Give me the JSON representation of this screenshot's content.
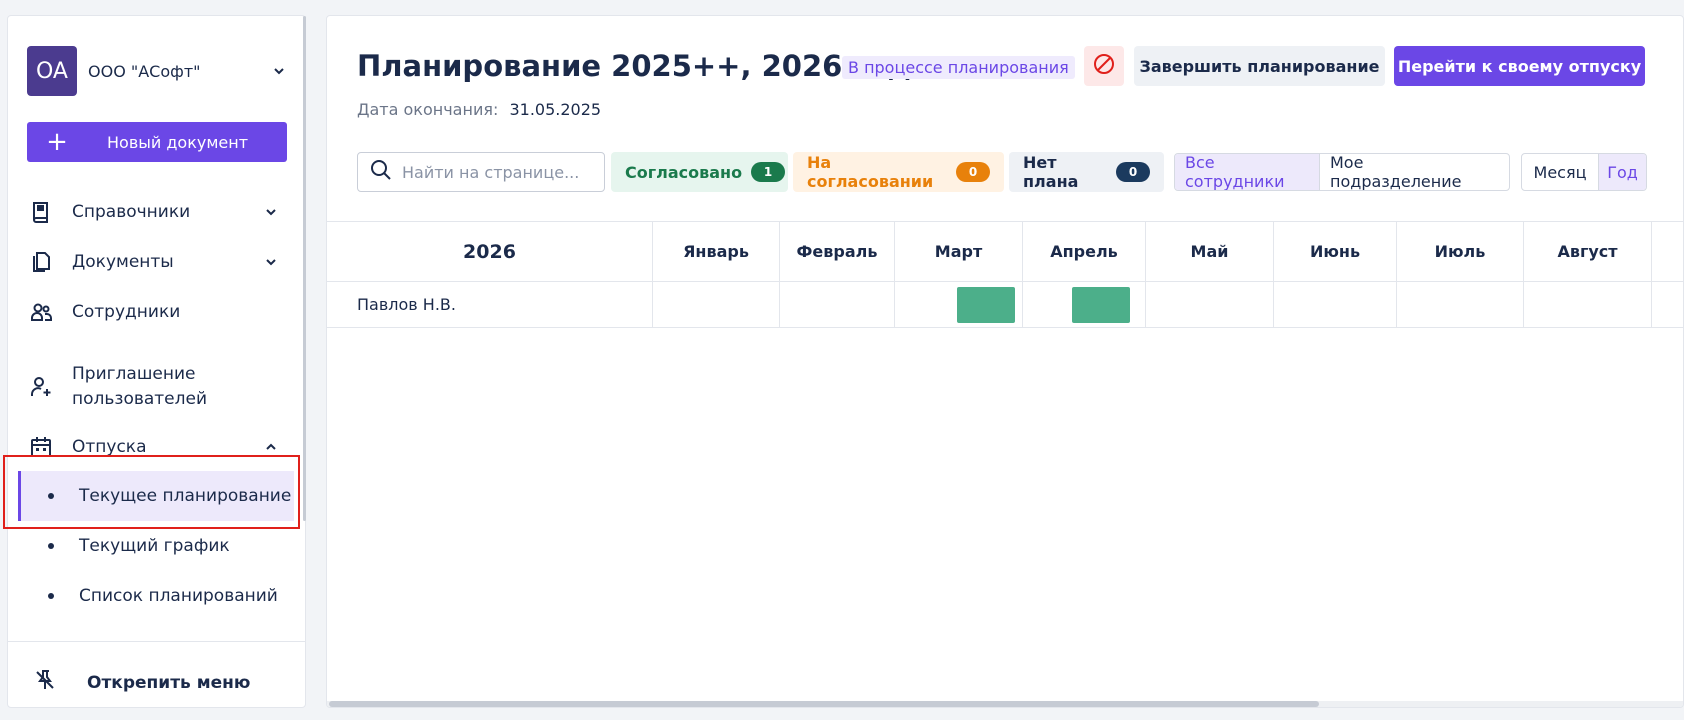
{
  "sidebar": {
    "org": {
      "avatar_initials": "OA",
      "name": "ООО \"АСофт\""
    },
    "new_document_label": "Новый документ",
    "items": [
      {
        "label": "Справочники",
        "icon": "book-icon"
      },
      {
        "label": "Документы",
        "icon": "documents-icon"
      },
      {
        "label": "Сотрудники",
        "icon": "employees-icon"
      },
      {
        "label": "Приглашение пользователей",
        "icon": "add-user-icon"
      },
      {
        "label": "Отпуска",
        "icon": "calendar-icon"
      }
    ],
    "vacation_subitems": [
      {
        "label": "Текущее планирование",
        "active": true
      },
      {
        "label": "Текущий график",
        "active": false
      },
      {
        "label": "Список планирований",
        "active": false
      }
    ],
    "unpin_label": "Открепить меню"
  },
  "header": {
    "title": "Планирование 2025++, 2026 год",
    "status": "В процессе планирования",
    "finish_label": "Завершить планирование",
    "goto_label": "Перейти к своему отпуску",
    "end_date_label": "Дата окончания:",
    "end_date_value": "31.05.2025"
  },
  "filters": {
    "search_placeholder": "Найти на странице...",
    "approved": {
      "label": "Согласовано",
      "count": "1"
    },
    "pending": {
      "label": "На согласовании",
      "count": "0"
    },
    "noplan": {
      "label": "Нет плана",
      "count": "0"
    },
    "scope": [
      "Все сотрудники",
      "Мое подразделение"
    ],
    "period": [
      "Месяц",
      "Год"
    ]
  },
  "table": {
    "year": "2026",
    "months": [
      "Январь",
      "Февраль",
      "Март",
      "Апрель",
      "Май",
      "Июнь",
      "Июль",
      "Август"
    ],
    "rows": [
      {
        "name": "Павлов Н.В."
      }
    ]
  },
  "colors": {
    "accent": "#6b47e6",
    "approved": "#1a7a4c",
    "pending": "#e8810b",
    "vacation_bar": "#4caf8a",
    "highlight": "#e0201b"
  }
}
